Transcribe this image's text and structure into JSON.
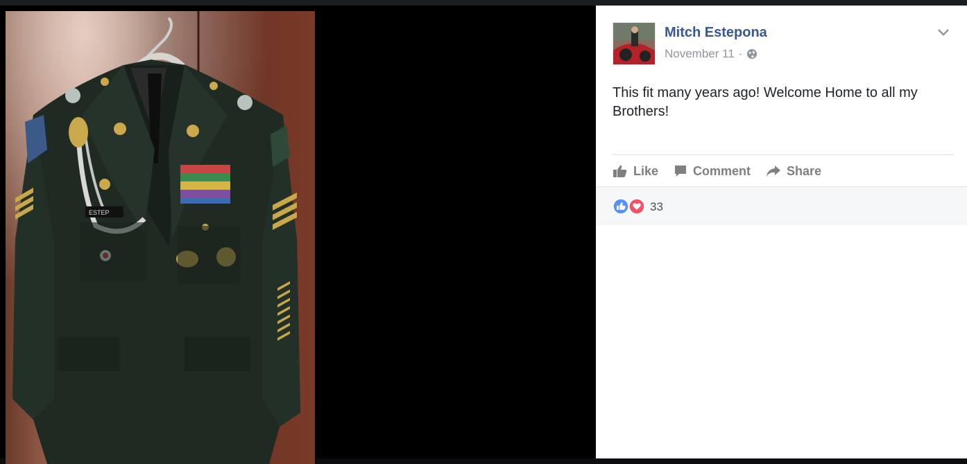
{
  "post": {
    "author": "Mitch Estepona",
    "date": "November 11",
    "separator": "·",
    "text": "This fit many years ago! Welcome Home to all my Brothers!",
    "privacy_icon": "globe-icon",
    "menu_icon": "chevron-down-icon"
  },
  "photo": {
    "nametag": "ESTEP",
    "subject": "military dress uniform"
  },
  "actions": {
    "like_label": "Like",
    "comment_label": "Comment",
    "share_label": "Share"
  },
  "reactions": {
    "count": "33",
    "icons": [
      "like-reaction-icon",
      "love-reaction-icon"
    ]
  },
  "colors": {
    "author_link": "#365899",
    "muted_text": "#90949c",
    "action_text": "#7f7f7f",
    "like_blue": "#5890ff",
    "love_red": "#f25268"
  }
}
